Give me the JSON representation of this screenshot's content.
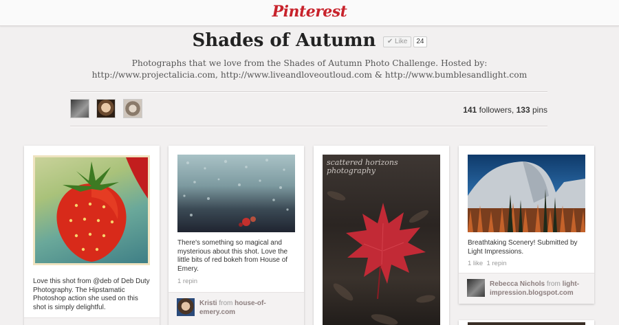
{
  "brand": {
    "logo_text": "Pinterest"
  },
  "board": {
    "title": "Shades of Autumn",
    "like_label": "✔ Like",
    "like_count": "24",
    "description": "Photographs that we love from the Shades of Autumn Photo Challenge. Hosted by: http://www.projectalicia.com, http://www.liveandloveoutloud.com & http://www.bumblesandlight.com",
    "followers_count": "141",
    "followers_label": "followers,",
    "pins_count": "133",
    "pins_label": "pins"
  },
  "pins": [
    {
      "description": "Love this shot from @deb of Deb Duty Photography. The Hipstamatic Photoshop action she used on this shot is simply delightful."
    },
    {
      "description": "There's something so magical and mysterious about this shot. Love the little bits of red bokeh from House of Emery.",
      "repins": "1 repin",
      "pinner": "Kristi",
      "from_word": "from",
      "source": "house-of-emery.com"
    },
    {
      "image_text": "scattered horizons photography"
    },
    {
      "description": "Breathtaking Scenery! Submitted by Light Impressions.",
      "likes": "1 like",
      "repins": "1 repin",
      "pinner": "Rebecca Nichols",
      "from_word": "from",
      "source": "light-impression.blogspot.com"
    }
  ],
  "colors": {
    "brand_red": "#c8232c",
    "background": "#f2f0f0"
  }
}
